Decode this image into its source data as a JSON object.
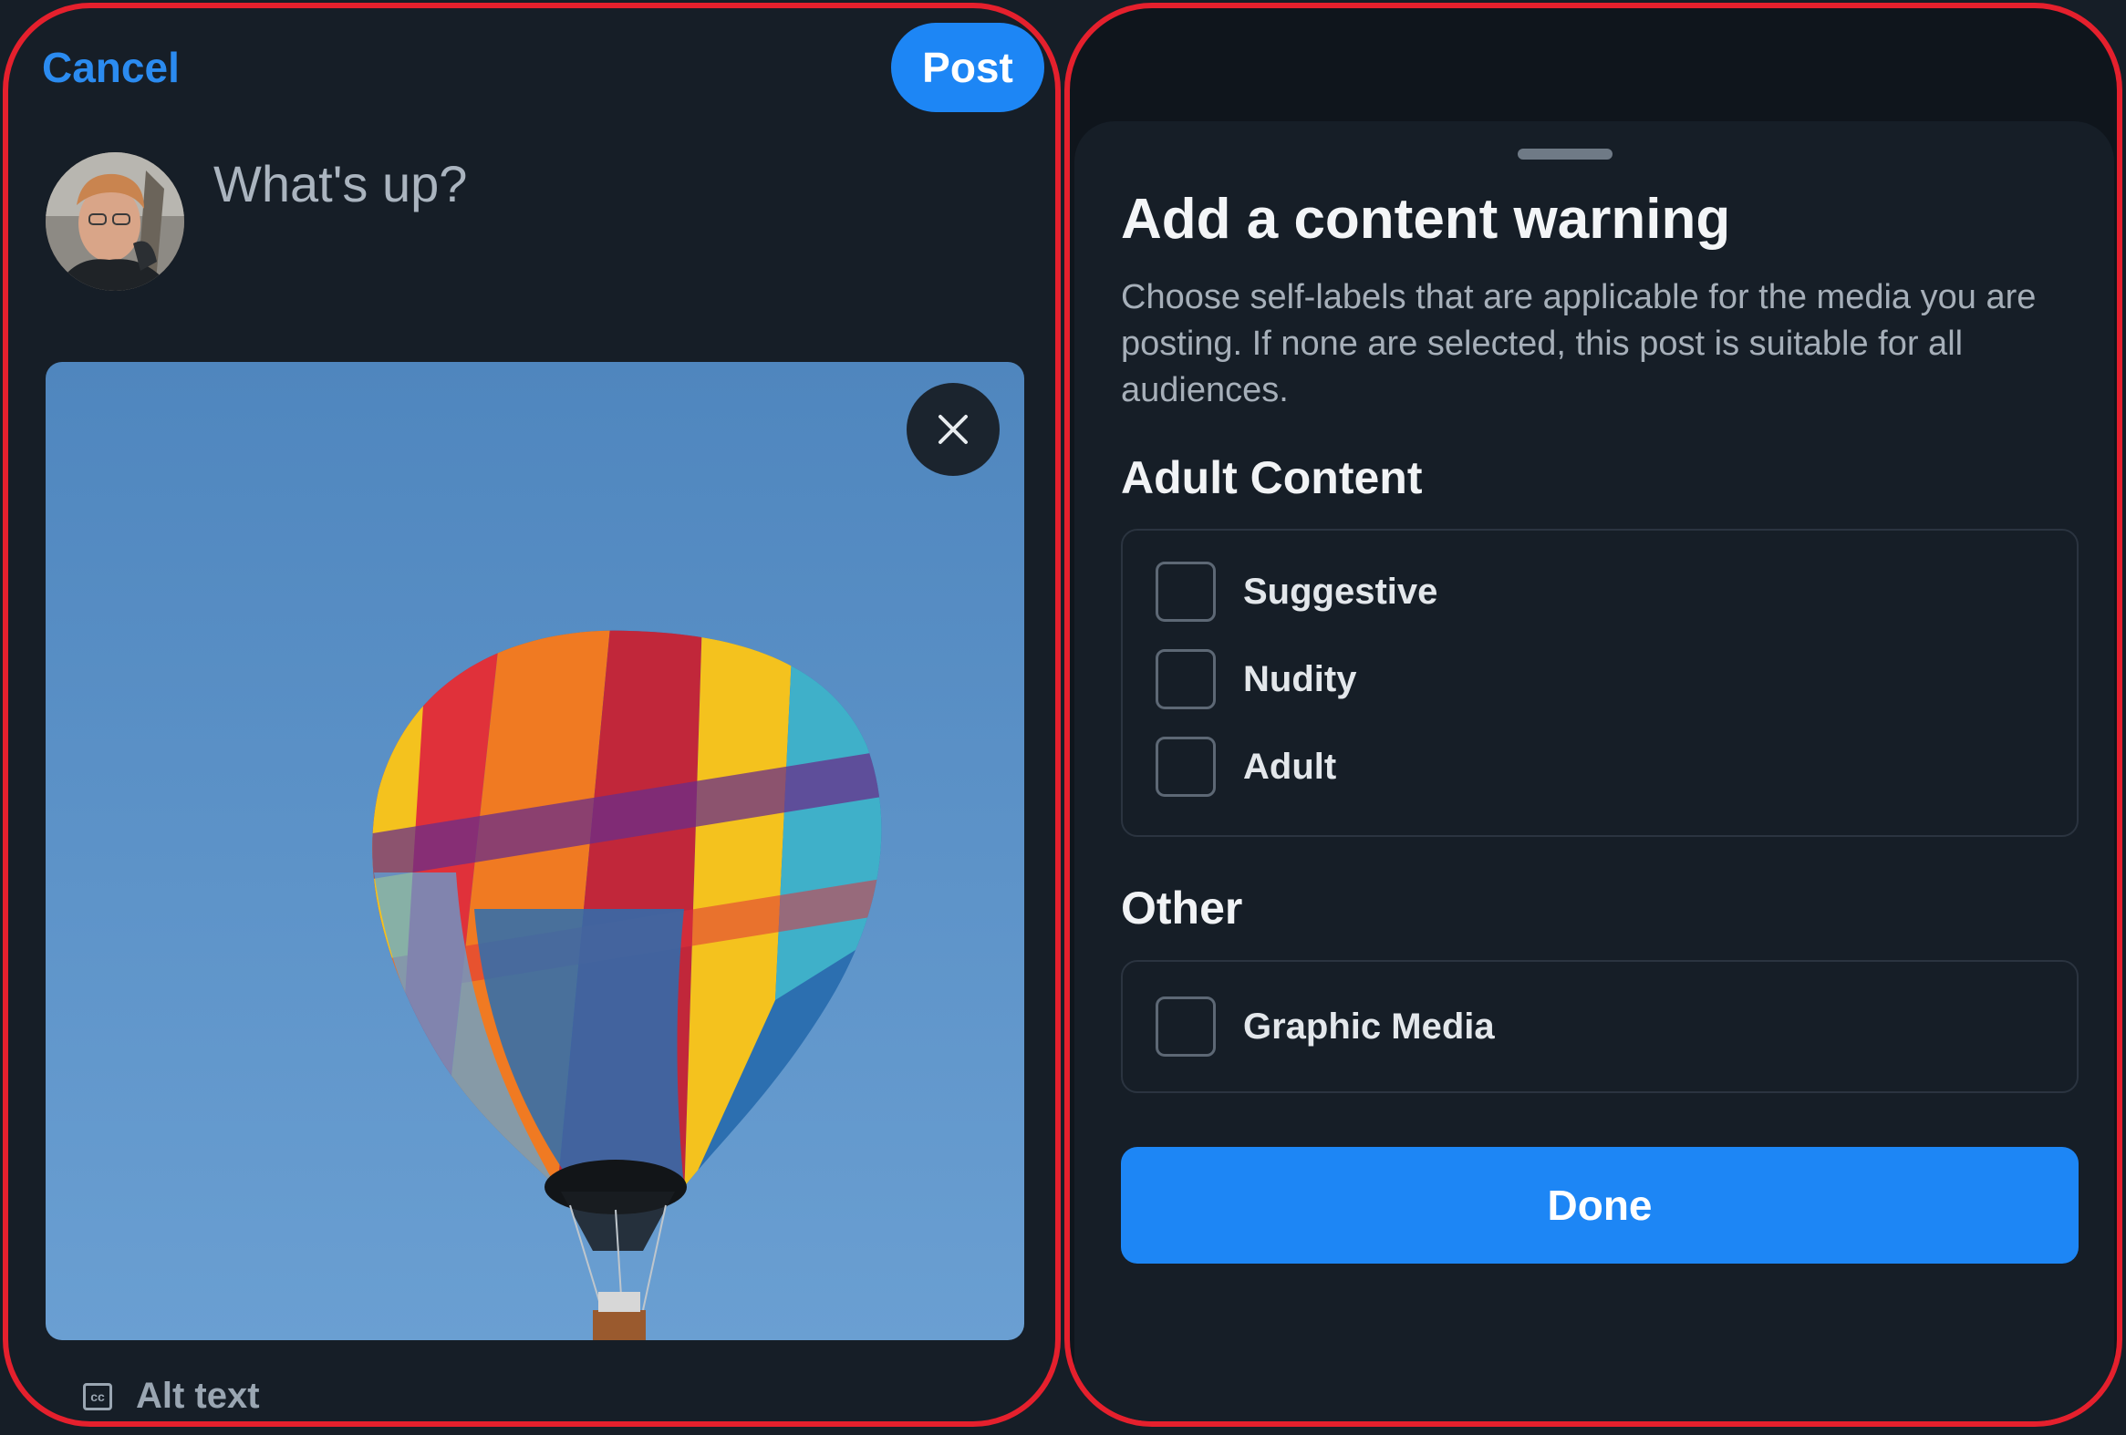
{
  "compose": {
    "cancel_label": "Cancel",
    "post_label": "Post",
    "placeholder": "What's up?",
    "alt_text_label": "Alt text",
    "icons": {
      "avatar": "user-avatar",
      "remove_media": "close-icon",
      "alt_text": "closed-caption-icon"
    }
  },
  "content_warning": {
    "title": "Add a content warning",
    "description": "Choose self-labels that are applicable for the media you are posting. If none are selected, this post is suitable for all audiences.",
    "sections": [
      {
        "heading": "Adult Content",
        "options": [
          {
            "label": "Suggestive",
            "checked": false
          },
          {
            "label": "Nudity",
            "checked": false
          },
          {
            "label": "Adult",
            "checked": false
          }
        ]
      },
      {
        "heading": "Other",
        "options": [
          {
            "label": "Graphic Media",
            "checked": false
          }
        ]
      }
    ],
    "done_label": "Done"
  },
  "colors": {
    "background": "#161e27",
    "accent": "#1d86f5",
    "frame_border": "#e5202d",
    "sky": "#5b92c9"
  }
}
